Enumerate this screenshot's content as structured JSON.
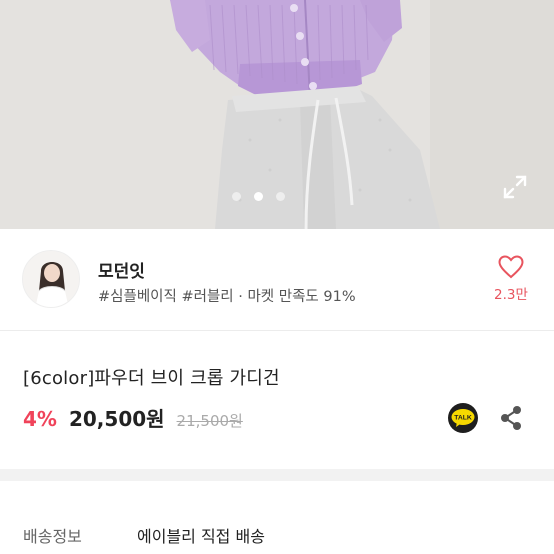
{
  "hero": {
    "carousel": {
      "page_count": 3,
      "active_index": 1
    },
    "expand_icon": "expand-icon"
  },
  "shop": {
    "name": "모던잇",
    "tags": "#심플베이직 #러블리 · 마켓 만족도 91%",
    "like_icon": "heart-icon",
    "like_count": "2.3만",
    "accent_color": "#e8545e"
  },
  "product": {
    "title": "[6color]파우더 브이 크롭 가디건",
    "discount": "4%",
    "price": "20,500원",
    "original_price": "21,500원",
    "discount_color": "#f0435a",
    "talk_icon": "kakaotalk-icon",
    "talk_label": "TALK",
    "share_icon": "share-icon"
  },
  "shipping": {
    "label": "배송정보",
    "value": "에이블리 직접 배송"
  }
}
